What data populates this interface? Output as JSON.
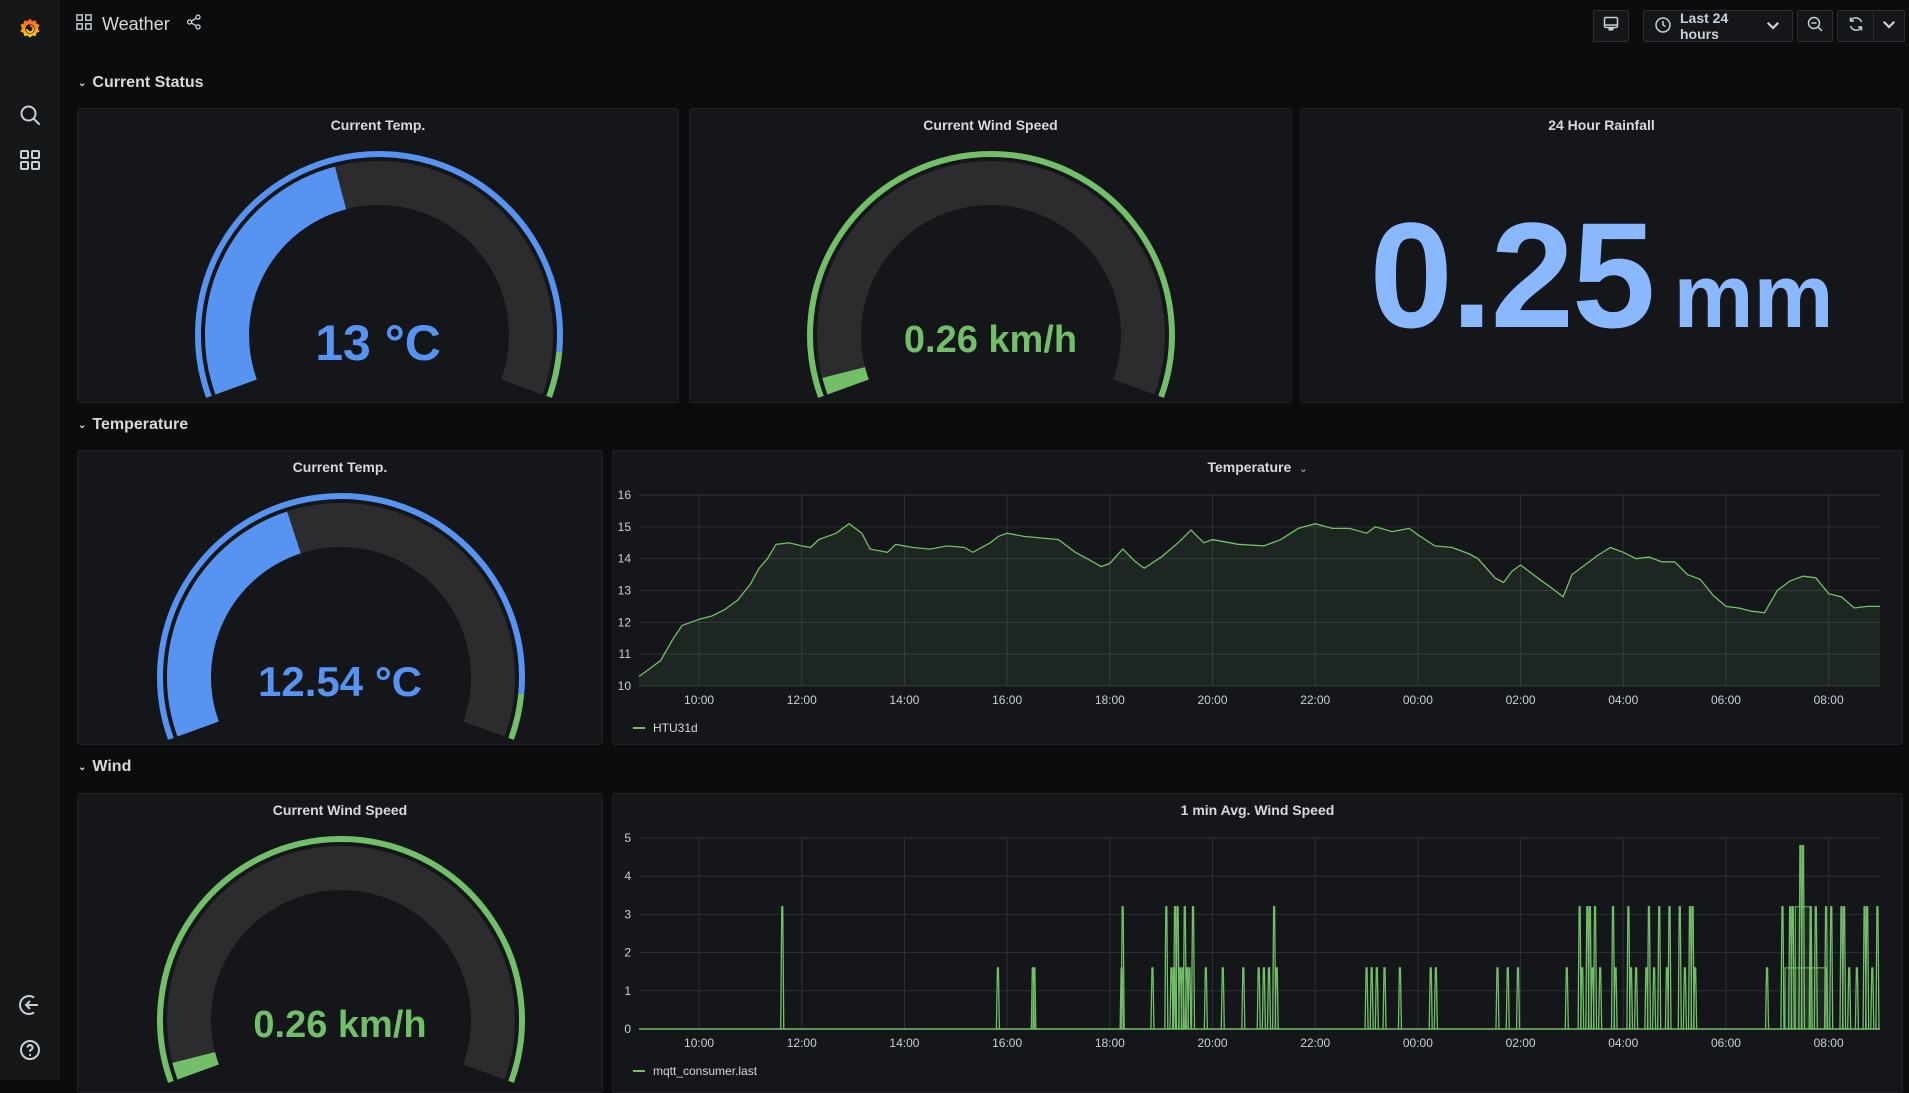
{
  "app": {
    "title": "Weather",
    "icons": {
      "logo": "grafana-logo-icon",
      "dashboard": "dashboard-grid-icon",
      "share": "share-icon"
    }
  },
  "sidebar": {
    "items": [
      {
        "name": "search",
        "icon": "search-icon"
      },
      {
        "name": "dashboards",
        "icon": "dashboards-grid-icon"
      }
    ],
    "bottom_items": [
      {
        "name": "sign-in",
        "icon": "sign-in-icon"
      },
      {
        "name": "help",
        "icon": "help-icon"
      }
    ]
  },
  "toolbar": {
    "tv_mode_icon": "monitor-icon",
    "time_range_label": "Last 24 hours",
    "zoom_out_icon": "zoom-out-icon",
    "refresh_icon": "refresh-icon",
    "refresh_menu_icon": "chevron-down-icon"
  },
  "rows": [
    {
      "title": "Current Status"
    },
    {
      "title": "Temperature"
    },
    {
      "title": "Wind"
    }
  ],
  "panels": {
    "current_temp": {
      "title": "Current Temp.",
      "value": 13,
      "display": "13 °C",
      "min": 0,
      "max": 30,
      "color": "#5794f2",
      "threshold_color": "#73bf69",
      "threshold": 28
    },
    "current_wind": {
      "title": "Current Wind Speed",
      "value": 0.26,
      "display": "0.26 km/h",
      "min": 0,
      "max": 10,
      "color": "#73bf69"
    },
    "rainfall": {
      "title": "24 Hour Rainfall",
      "value": "0.25",
      "unit": "mm",
      "color": "#8ab8ff"
    },
    "temp_gauge": {
      "title": "Current Temp.",
      "value": 12.54,
      "display": "12.54 °C",
      "min": 0,
      "max": 30,
      "color": "#5794f2",
      "threshold_color": "#73bf69",
      "threshold": 28
    },
    "temp_chart": {
      "title": "Temperature",
      "legend": "HTU31d"
    },
    "wind_gauge": {
      "title": "Current Wind Speed",
      "value": 0.26,
      "display": "0.26 km/h",
      "min": 0,
      "max": 10,
      "color": "#73bf69"
    },
    "wind_chart": {
      "title": "1 min Avg. Wind Speed",
      "legend": "mqtt_consumer.last"
    }
  },
  "chart_data": [
    {
      "type": "area",
      "title": "Temperature",
      "xlabel": "",
      "ylabel": "",
      "ylim": [
        10,
        16
      ],
      "yticks": [
        10,
        11,
        12,
        13,
        14,
        15,
        16
      ],
      "xticks": [
        "10:00",
        "12:00",
        "14:00",
        "16:00",
        "18:00",
        "20:00",
        "22:00",
        "00:00",
        "02:00",
        "04:00",
        "06:00",
        "08:00"
      ],
      "x_hours_range": [
        -1.17,
        23.0
      ],
      "grid": true,
      "legend": "bottom-left",
      "series": [
        {
          "name": "HTU31d",
          "color": "#73bf69",
          "x_hours_from_10": [
            -1.17,
            -1.0,
            -0.75,
            -0.5,
            -0.33,
            0,
            0.25,
            0.5,
            0.75,
            1.0,
            1.17,
            1.33,
            1.5,
            1.75,
            2.0,
            2.17,
            2.33,
            2.67,
            2.92,
            3.17,
            3.33,
            3.67,
            3.83,
            4.17,
            4.5,
            4.83,
            5.17,
            5.33,
            5.67,
            5.83,
            6.0,
            6.33,
            6.67,
            7.0,
            7.33,
            7.67,
            7.83,
            8.0,
            8.25,
            8.5,
            8.67,
            9.0,
            9.33,
            9.58,
            9.83,
            10.0,
            10.5,
            11.0,
            11.33,
            11.67,
            12.0,
            12.33,
            12.67,
            13.0,
            13.17,
            13.5,
            13.83,
            14.0,
            14.33,
            14.67,
            15.0,
            15.17,
            15.5,
            15.67,
            15.83,
            16.0,
            16.33,
            16.67,
            16.83,
            17.0,
            17.25,
            17.5,
            17.75,
            18.0,
            18.25,
            18.5,
            18.75,
            19.0,
            19.25,
            19.5,
            19.75,
            20.0,
            20.25,
            20.5,
            20.75,
            21.0,
            21.25,
            21.5,
            21.75,
            22.0,
            22.25,
            22.5,
            22.75,
            23.0
          ],
          "values": [
            10.3,
            10.5,
            10.8,
            11.5,
            11.9,
            12.1,
            12.2,
            12.4,
            12.7,
            13.2,
            13.7,
            14.0,
            14.45,
            14.5,
            14.4,
            14.35,
            14.6,
            14.8,
            15.1,
            14.8,
            14.3,
            14.2,
            14.45,
            14.35,
            14.3,
            14.4,
            14.35,
            14.2,
            14.5,
            14.7,
            14.8,
            14.7,
            14.65,
            14.6,
            14.2,
            13.9,
            13.75,
            13.85,
            14.3,
            13.9,
            13.7,
            14.05,
            14.5,
            14.9,
            14.5,
            14.6,
            14.45,
            14.4,
            14.6,
            14.95,
            15.1,
            14.95,
            14.95,
            14.8,
            15.0,
            14.85,
            14.95,
            14.75,
            14.4,
            14.35,
            14.15,
            14.0,
            13.4,
            13.25,
            13.6,
            13.8,
            13.4,
            13.0,
            12.8,
            13.5,
            13.8,
            14.1,
            14.35,
            14.2,
            14.0,
            14.05,
            13.9,
            13.9,
            13.5,
            13.35,
            12.85,
            12.5,
            12.45,
            12.35,
            12.3,
            13.0,
            13.3,
            13.45,
            13.4,
            12.9,
            12.8,
            12.45,
            12.5,
            12.5
          ]
        }
      ]
    },
    {
      "type": "line",
      "title": "1 min Avg. Wind Speed",
      "xlabel": "",
      "ylabel": "",
      "ylim": [
        0,
        5
      ],
      "yticks": [
        0,
        1,
        2,
        3,
        4,
        5
      ],
      "xticks": [
        "10:00",
        "12:00",
        "14:00",
        "16:00",
        "18:00",
        "20:00",
        "22:00",
        "00:00",
        "02:00",
        "04:00",
        "06:00",
        "08:00"
      ],
      "x_hours_range": [
        -1.17,
        23.0
      ],
      "grid": true,
      "legend": "bottom-left",
      "baseline": 0,
      "series": [
        {
          "name": "mqtt_consumer.last",
          "color": "#73bf69",
          "spikes": [
            {
              "x": 1.62,
              "v": 3.2
            },
            {
              "x": 5.82,
              "v": 1.6
            },
            {
              "x": 6.5,
              "v": 1.6
            },
            {
              "x": 6.53,
              "v": 1.6
            },
            {
              "x": 8.25,
              "v": 3.2
            },
            {
              "x": 8.23,
              "v": 1.6
            },
            {
              "x": 8.83,
              "v": 1.6
            },
            {
              "x": 9.1,
              "v": 3.2
            },
            {
              "x": 9.2,
              "v": 1.6
            },
            {
              "x": 9.25,
              "v": 1.6
            },
            {
              "x": 9.27,
              "v": 3.2
            },
            {
              "x": 9.32,
              "v": 3.2
            },
            {
              "x": 9.37,
              "v": 1.6
            },
            {
              "x": 9.42,
              "v": 1.6
            },
            {
              "x": 9.46,
              "v": 3.2
            },
            {
              "x": 9.5,
              "v": 1.6
            },
            {
              "x": 9.55,
              "v": 1.6
            },
            {
              "x": 9.62,
              "v": 3.2
            },
            {
              "x": 9.87,
              "v": 1.6
            },
            {
              "x": 10.2,
              "v": 1.6
            },
            {
              "x": 10.6,
              "v": 1.6
            },
            {
              "x": 10.9,
              "v": 1.6
            },
            {
              "x": 11.0,
              "v": 1.6
            },
            {
              "x": 11.1,
              "v": 1.6
            },
            {
              "x": 11.2,
              "v": 3.2
            },
            {
              "x": 11.25,
              "v": 1.6
            },
            {
              "x": 13.0,
              "v": 1.6
            },
            {
              "x": 13.1,
              "v": 1.6
            },
            {
              "x": 13.2,
              "v": 1.6
            },
            {
              "x": 13.35,
              "v": 1.6
            },
            {
              "x": 13.65,
              "v": 1.6
            },
            {
              "x": 14.25,
              "v": 1.6
            },
            {
              "x": 14.35,
              "v": 1.6
            },
            {
              "x": 15.55,
              "v": 1.6
            },
            {
              "x": 15.75,
              "v": 1.6
            },
            {
              "x": 15.95,
              "v": 1.6
            },
            {
              "x": 16.9,
              "v": 1.6
            },
            {
              "x": 17.15,
              "v": 3.2
            },
            {
              "x": 17.2,
              "v": 1.6
            },
            {
              "x": 17.3,
              "v": 3.2
            },
            {
              "x": 17.35,
              "v": 3.2
            },
            {
              "x": 17.4,
              "v": 1.6
            },
            {
              "x": 17.45,
              "v": 3.2
            },
            {
              "x": 17.55,
              "v": 1.6
            },
            {
              "x": 17.8,
              "v": 3.2
            },
            {
              "x": 17.85,
              "v": 1.6
            },
            {
              "x": 18.1,
              "v": 3.2
            },
            {
              "x": 18.15,
              "v": 1.6
            },
            {
              "x": 18.25,
              "v": 1.6
            },
            {
              "x": 18.45,
              "v": 1.6
            },
            {
              "x": 18.5,
              "v": 3.2
            },
            {
              "x": 18.6,
              "v": 1.6
            },
            {
              "x": 18.7,
              "v": 3.2
            },
            {
              "x": 18.85,
              "v": 1.6
            },
            {
              "x": 18.9,
              "v": 3.2
            },
            {
              "x": 19.1,
              "v": 3.2
            },
            {
              "x": 19.2,
              "v": 1.6
            },
            {
              "x": 19.3,
              "v": 3.2
            },
            {
              "x": 19.35,
              "v": 3.2
            },
            {
              "x": 19.4,
              "v": 1.6
            },
            {
              "x": 20.8,
              "v": 1.6
            },
            {
              "x": 21.1,
              "v": 3.2
            },
            {
              "x": 21.25,
              "v": 3.2
            },
            {
              "x": 21.3,
              "v": 3.2
            },
            {
              "x": 21.45,
              "v": 4.8
            },
            {
              "x": 21.5,
              "v": 4.8
            },
            {
              "x": 21.65,
              "v": 3.2
            },
            {
              "x": 21.75,
              "v": 3.2
            },
            {
              "x": 21.95,
              "v": 3.2
            },
            {
              "x": 22.05,
              "v": 3.2
            },
            {
              "x": 22.25,
              "v": 3.2
            },
            {
              "x": 22.3,
              "v": 3.2
            },
            {
              "x": 22.4,
              "v": 1.6
            },
            {
              "x": 22.55,
              "v": 1.6
            },
            {
              "x": 22.7,
              "v": 3.2
            },
            {
              "x": 22.75,
              "v": 3.2
            },
            {
              "x": 22.85,
              "v": 1.6
            },
            {
              "x": 22.95,
              "v": 3.2
            }
          ],
          "sustained": [
            {
              "from": 21.15,
              "to": 21.95,
              "v": 1.6
            },
            {
              "from": 21.35,
              "to": 21.65,
              "v": 3.2
            }
          ]
        }
      ]
    }
  ]
}
